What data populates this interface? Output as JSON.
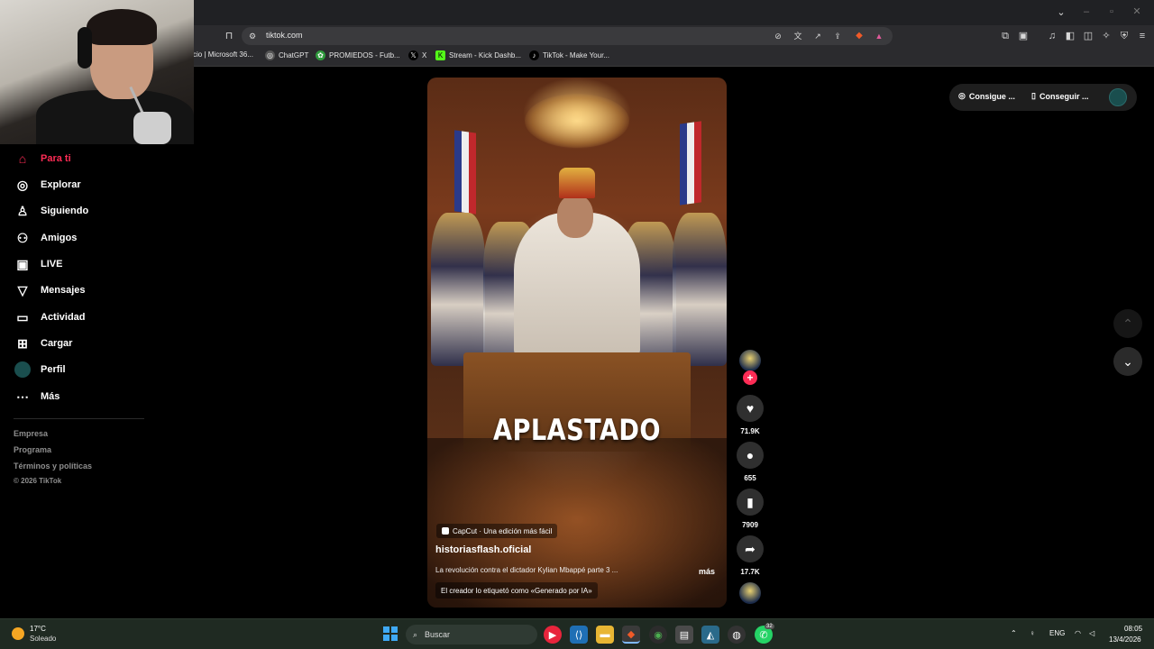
{
  "browser": {
    "url": "tiktok.com",
    "bookmarks": [
      {
        "label": "cio | Microsoft 36...",
        "icon": "microsoft-icon"
      },
      {
        "label": "ChatGPT",
        "icon": "chatgpt-icon"
      },
      {
        "label": "PROMIEDOS - Futb...",
        "icon": "promiedos-icon"
      },
      {
        "label": "X",
        "icon": "x-icon"
      },
      {
        "label": "Stream - Kick Dashb...",
        "icon": "kick-icon"
      },
      {
        "label": "TikTok - Make Your...",
        "icon": "tiktok-icon"
      }
    ]
  },
  "sidebar": {
    "items": [
      {
        "label": "Para ti",
        "icon": "home-icon",
        "active": true
      },
      {
        "label": "Explorar",
        "icon": "compass-icon"
      },
      {
        "label": "Siguiendo",
        "icon": "following-icon"
      },
      {
        "label": "Amigos",
        "icon": "friends-icon"
      },
      {
        "label": "LIVE",
        "icon": "live-icon"
      },
      {
        "label": "Mensajes",
        "icon": "messages-icon"
      },
      {
        "label": "Actividad",
        "icon": "activity-icon"
      },
      {
        "label": "Cargar",
        "icon": "upload-icon"
      },
      {
        "label": "Perfil",
        "icon": "profile-icon"
      },
      {
        "label": "Más",
        "icon": "more-icon"
      }
    ],
    "footer": {
      "company": "Empresa",
      "program": "Programa",
      "terms": "Términos y políticas",
      "copyright": "© 2026 TikTok"
    }
  },
  "video": {
    "overlay_text": "APLASTADO",
    "capcut_tag": "CapCut · Una edición más fácil",
    "author": "historiasflash.oficial",
    "caption": "La revolución contra el dictador Kylian Mbappé parte 3 ...",
    "more": "más",
    "ai_label": "El creador lo etiquetó como «Generado por IA»"
  },
  "actions": {
    "likes": "71.9K",
    "comments": "655",
    "saves": "7909",
    "shares": "17.7K"
  },
  "top_bar": {
    "coins_label": "Consigue ...",
    "app_label": "Conseguir ..."
  },
  "taskbar": {
    "weather_temp": "17°C",
    "weather_desc": "Soleado",
    "search_placeholder": "Buscar",
    "language": "ENG",
    "time": "08:05",
    "date": "13/4/2026",
    "whatsapp_badge": "32"
  },
  "colors": {
    "accent": "#fe2c55",
    "background": "#000000",
    "taskbar": "#1f2a22"
  }
}
